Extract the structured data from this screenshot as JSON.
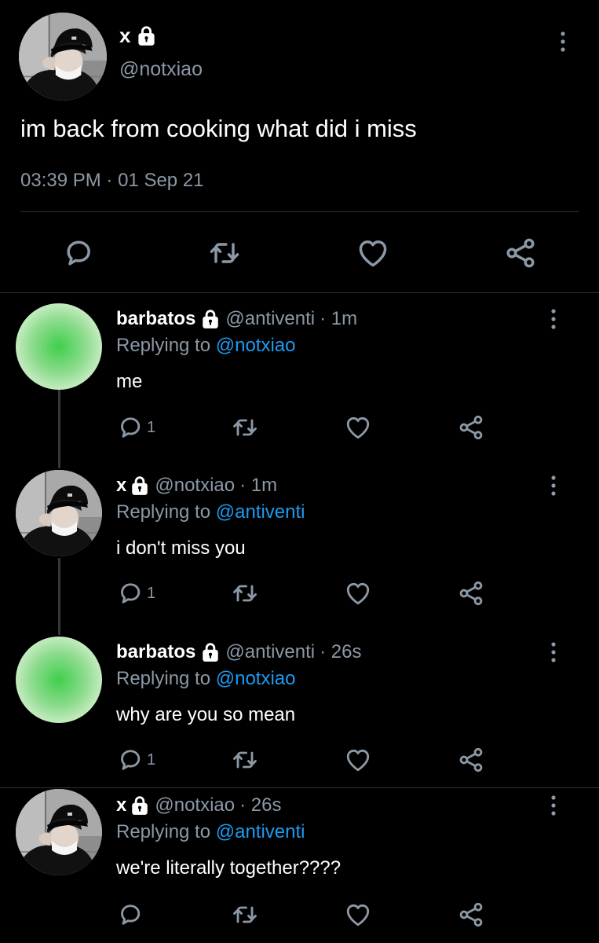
{
  "main_tweet": {
    "name": "x",
    "handle": "@notxiao",
    "text": "im back from cooking what did i miss",
    "time": "03:39 PM",
    "dot": "·",
    "date": "01 Sep 21"
  },
  "replies": [
    {
      "name": "barbatos",
      "handle": "@antiventi",
      "time": "· 1m",
      "replying_label": "Replying to",
      "replying_to": "@notxiao",
      "text": "me",
      "reply_count": "1",
      "avatar": "green-gradient"
    },
    {
      "name": "x",
      "handle": "@notxiao",
      "time": "· 1m",
      "replying_label": "Replying to",
      "replying_to": "@antiventi",
      "text": "i don't miss you",
      "reply_count": "1",
      "avatar": "photo"
    },
    {
      "name": "barbatos",
      "handle": "@antiventi",
      "time": "· 26s",
      "replying_label": "Replying to",
      "replying_to": "@notxiao",
      "text": "why are you so mean",
      "reply_count": "1",
      "avatar": "green-gradient"
    },
    {
      "name": "x",
      "handle": "@notxiao",
      "time": "· 26s",
      "replying_label": "Replying to",
      "replying_to": "@antiventi",
      "text": "we're literally together????",
      "reply_count": "",
      "avatar": "photo"
    }
  ],
  "icons": [
    "lock-icon",
    "more-icon",
    "reply-icon",
    "retweet-icon",
    "like-icon",
    "share-icon"
  ],
  "colors": {
    "background": "#000000",
    "text": "#ffffff",
    "muted": "#8b98a5",
    "link": "#1d9bf0",
    "divider": "#2f3336"
  }
}
